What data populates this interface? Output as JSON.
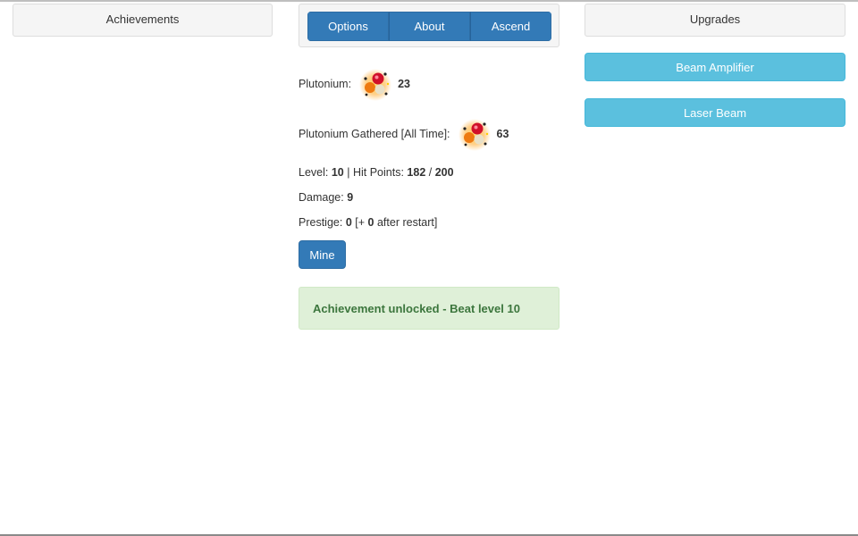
{
  "achievements": {
    "heading": "Achievements"
  },
  "nav": {
    "options": "Options",
    "about": "About",
    "ascend": "Ascend"
  },
  "stats": {
    "plutonium_label": "Plutonium:",
    "plutonium_value": "23",
    "gathered_label": "Plutonium Gathered [All Time]:",
    "gathered_value": "63",
    "level_label": "Level:",
    "level_value": "10",
    "sep": "|",
    "hp_label": "Hit Points:",
    "hp_current": "182",
    "hp_slash": "/",
    "hp_max": "200",
    "damage_label": "Damage:",
    "damage_value": "9",
    "prestige_label": "Prestige:",
    "prestige_value": "0",
    "prestige_open": "[+",
    "prestige_pending": "0",
    "prestige_close": "after restart]"
  },
  "mine_label": "Mine",
  "alert_text": "Achievement unlocked - Beat level 10",
  "upgrades": {
    "heading": "Upgrades",
    "items": [
      "Beam Amplifier",
      "Laser Beam"
    ]
  },
  "icons": {
    "plutonium": "plutonium-atom-icon"
  },
  "colors": {
    "primary": "#337ab7",
    "info": "#5bc0de",
    "success_bg": "#dff0d8",
    "success_text": "#3c763d"
  }
}
